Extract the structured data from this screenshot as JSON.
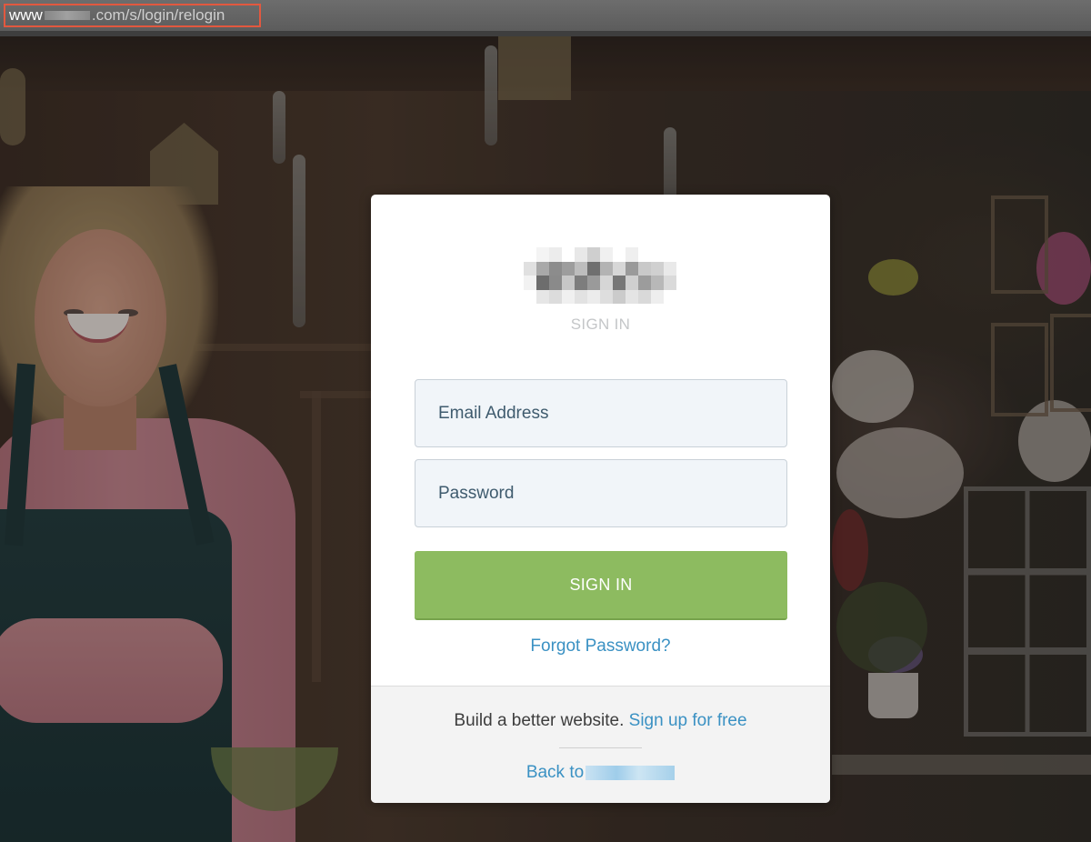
{
  "address_bar": {
    "url_prefix": "www",
    "url_suffix": ".com/s/login/relogin",
    "highlight_color": "#e2583f"
  },
  "login": {
    "title": "SIGN IN",
    "email_placeholder": "Email Address",
    "password_placeholder": "Password",
    "submit_label": "SIGN IN",
    "forgot_label": "Forgot Password?"
  },
  "footer": {
    "build_text": "Build a better website.",
    "signup_label": "Sign up for free",
    "back_prefix": "Back to"
  },
  "colors": {
    "accent_green": "#8dbb60",
    "link_blue": "#3a91c3",
    "field_bg": "#f1f5f9"
  },
  "icons": {
    "logo": "pixelated-brand-logo"
  }
}
